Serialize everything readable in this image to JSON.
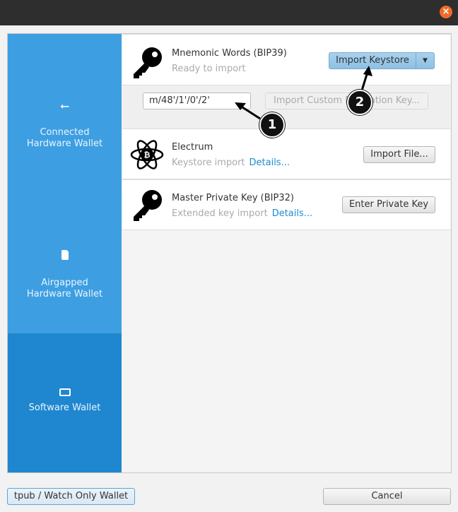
{
  "sidebar": {
    "items": [
      {
        "label": "Connected\nHardware Wallet",
        "icon": "usb-icon",
        "selected": false
      },
      {
        "label": "Airgapped\nHardware Wallet",
        "icon": "sd-card-icon",
        "selected": false
      },
      {
        "label": "Software Wallet",
        "icon": "laptop-icon",
        "selected": true
      }
    ]
  },
  "importers": [
    {
      "title": "Mnemonic Words (BIP39)",
      "subtitle": "Ready to import",
      "button": "Import Keystore",
      "icon": "key-icon"
    },
    {
      "title": "Electrum",
      "subtitle": "Keystore import",
      "link": "Details...",
      "button": "Import File...",
      "icon": "electrum-icon"
    },
    {
      "title": "Master Private Key (BIP32)",
      "subtitle": "Extended key import",
      "link": "Details...",
      "button": "Enter Private Key",
      "icon": "key-icon"
    }
  ],
  "derivation": {
    "value": "m/48'/1'/0'/2'",
    "custom_button": "Import Custom Derivation Key..."
  },
  "callouts": [
    "1",
    "2"
  ],
  "footer": {
    "watch_only": "tpub / Watch Only Wallet",
    "cancel": "Cancel"
  },
  "colors": {
    "sidebar": "#3d9fe2",
    "sidebar_selected": "#1f87cf",
    "link": "#1e8bd0",
    "close": "#f06a2a"
  }
}
